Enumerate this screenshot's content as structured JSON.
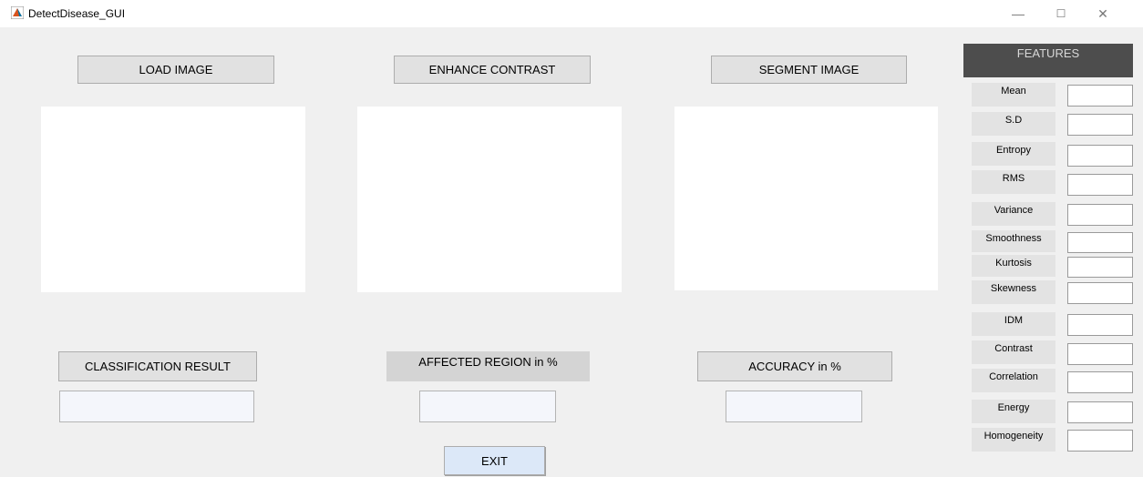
{
  "window": {
    "title": "DetectDisease_GUI",
    "minimize_glyph": "—",
    "maximize_glyph": "☐",
    "close_glyph": "✕"
  },
  "buttons": {
    "load_image": "LOAD IMAGE",
    "enhance_contrast": "ENHANCE CONTRAST",
    "segment_image": "SEGMENT IMAGE",
    "classification_result": "CLASSIFICATION RESULT",
    "accuracy": "ACCURACY in %",
    "exit": "EXIT"
  },
  "labels": {
    "affected_region": "AFFECTED REGION in %"
  },
  "features": {
    "header": "FEATURES",
    "items": [
      "Mean",
      "S.D",
      "Entropy",
      "RMS",
      "Variance",
      "Smoothness",
      "Kurtosis",
      "Skewness",
      "IDM",
      "Contrast",
      "Correlation",
      "Energy",
      "Homogeneity"
    ],
    "values": [
      "",
      "",
      "",
      "",
      "",
      "",
      "",
      "",
      "",
      "",
      "",
      "",
      ""
    ]
  },
  "results": {
    "classification_value": "",
    "affected_region_value": "",
    "accuracy_value": ""
  },
  "colors": {
    "background": "#f0f0f0",
    "features_header_bg": "#4d4d4d",
    "exit_button_bg": "#dce8f8"
  }
}
